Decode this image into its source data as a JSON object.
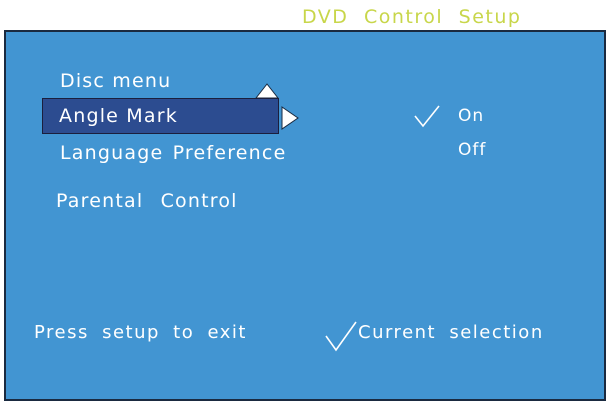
{
  "header": {
    "title": "DVD  Control  Setup"
  },
  "menu": {
    "items": [
      {
        "label": "Disc menu"
      },
      {
        "label": "Angle Mark",
        "selected": true
      },
      {
        "label": "Language Preference"
      },
      {
        "label": "Parental  Control"
      }
    ]
  },
  "options": {
    "items": [
      {
        "label": "On",
        "checked": true
      },
      {
        "label": "Off",
        "checked": false
      }
    ]
  },
  "footer": {
    "exit_hint": "Press  setup  to  exit",
    "legend": "Current  selection"
  },
  "colors": {
    "title": "#c8d64a",
    "panel_background": "#4295d2",
    "selection_background": "#2c4c90",
    "text": "#ffffff"
  },
  "icons": {
    "up_arrow": "triangle-up-icon",
    "right_arrow": "triangle-right-icon",
    "checkmark": "checkmark-icon"
  }
}
